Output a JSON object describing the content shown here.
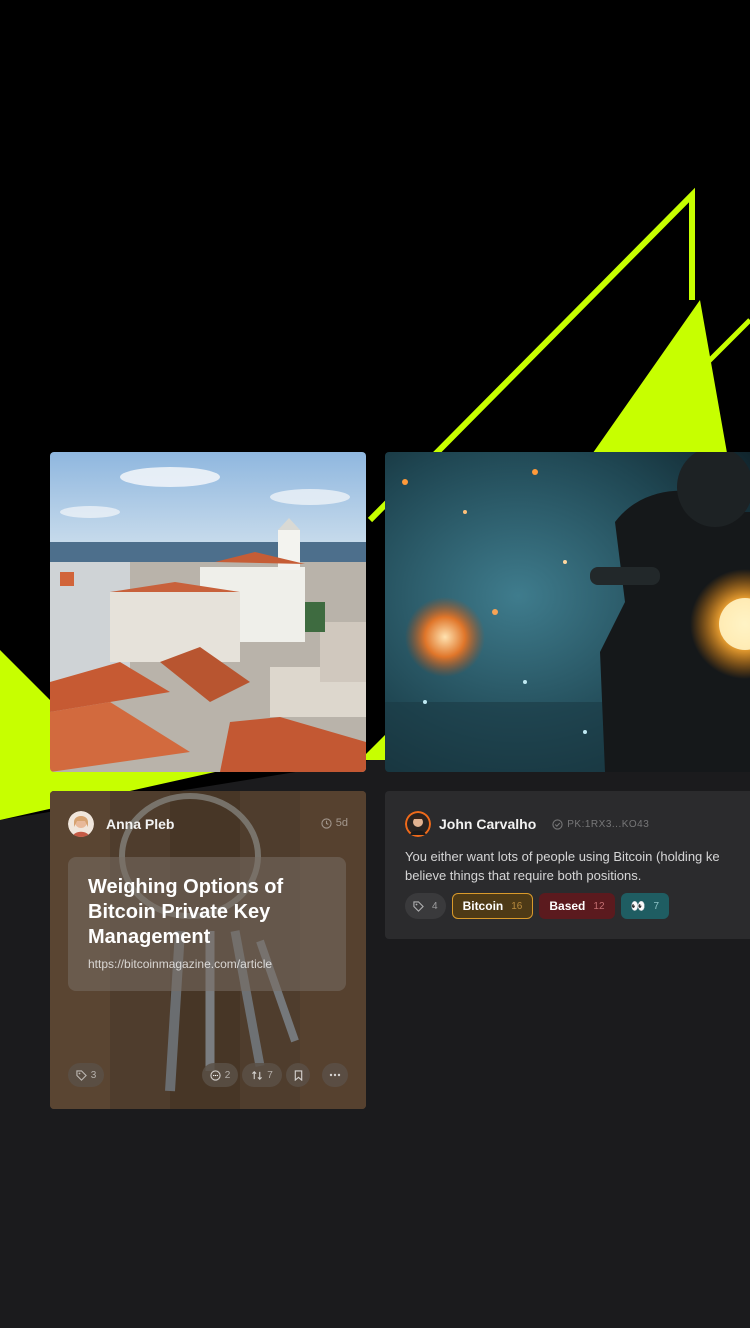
{
  "colors": {
    "accent": "#c7ff00",
    "background_top": "#000000",
    "background_bottom": "#1b1b1d",
    "card": "#2b2b2d"
  },
  "images": {
    "city": "city-rooftops-photo",
    "moto": "motorcycle-rider-photo"
  },
  "article_card": {
    "author": "Anna Pleb",
    "time": "5d",
    "title": "Weighing Options of Bitcoin Private Key Management",
    "url": "https://bitcoinmagazine.com/article",
    "tags_count": "3",
    "comments_count": "2",
    "reposts_count": "7"
  },
  "note_card": {
    "author": "John Carvalho",
    "pubkey": "PK:1RX3...KO43",
    "text_line1": "You either want lots of people using Bitcoin (holding ke",
    "text_line2": "believe things that require both positions.",
    "tags_count": "4",
    "reactions": [
      {
        "label": "Bitcoin",
        "count": "16"
      },
      {
        "label": "Based",
        "count": "12"
      },
      {
        "label": "👀",
        "count": "7"
      }
    ]
  }
}
